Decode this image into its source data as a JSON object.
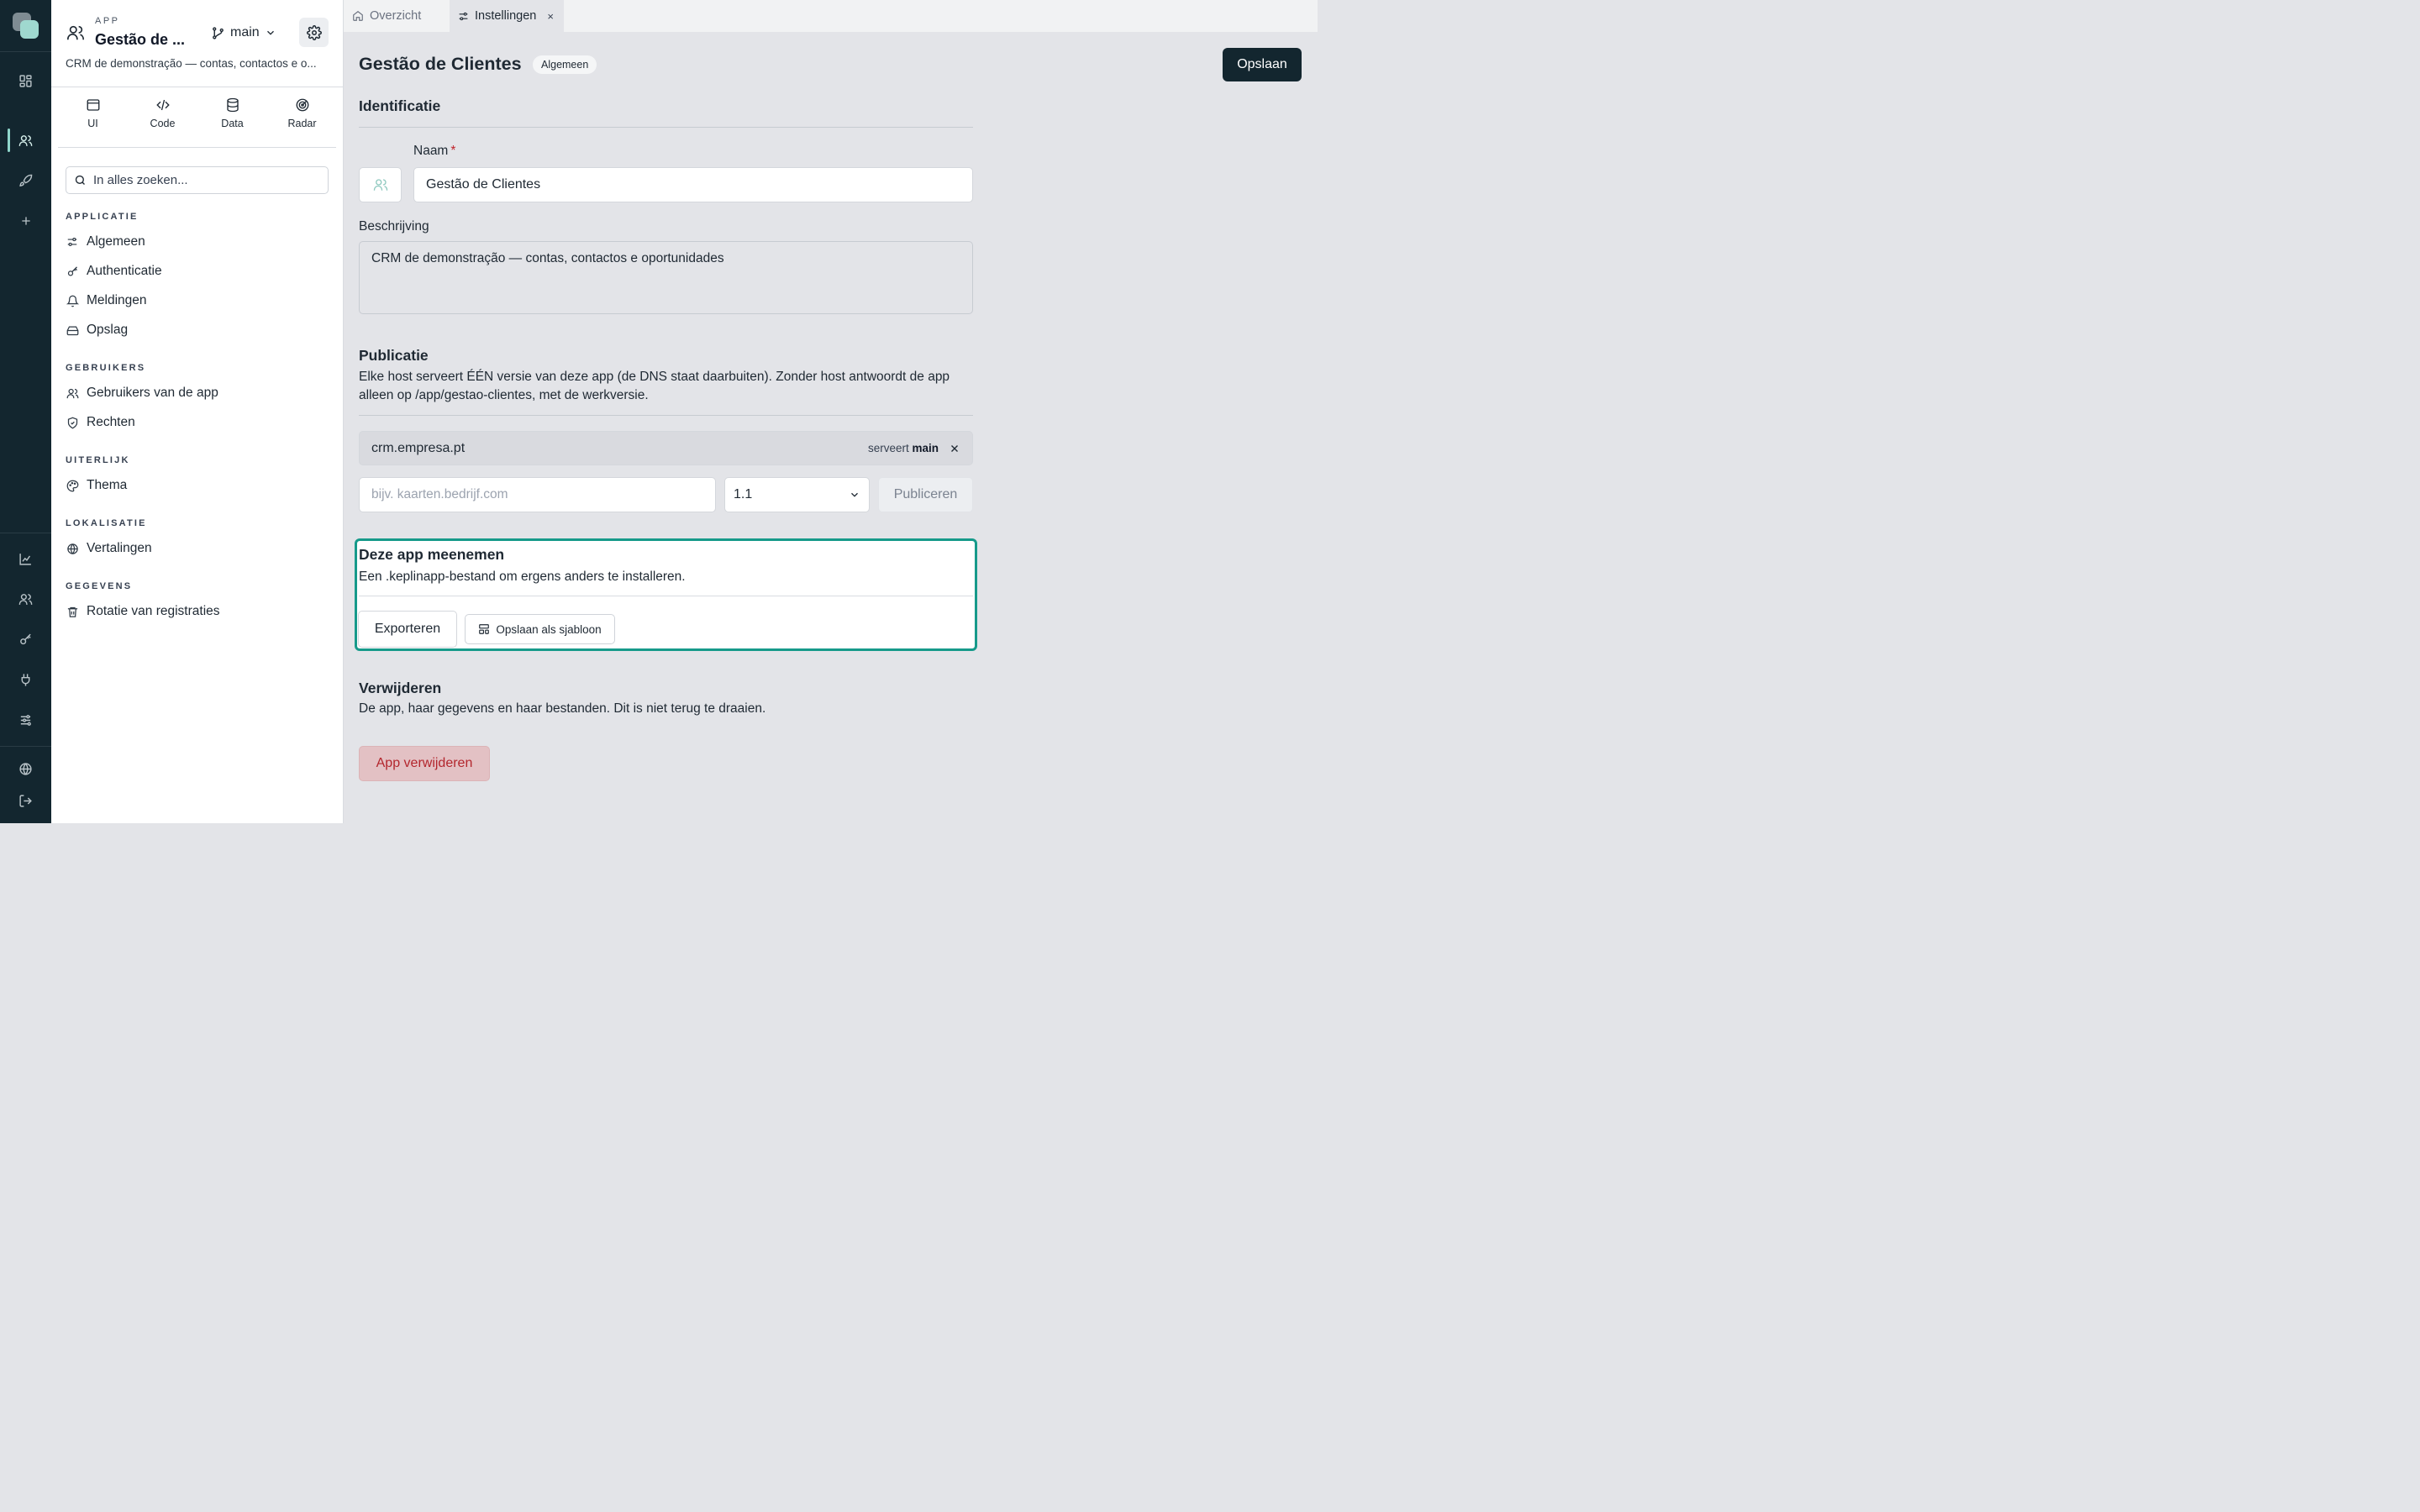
{
  "app": {
    "kicker": "APP",
    "title": "Gestão de ...",
    "branch": "main",
    "description": "CRM de demonstração — contas, contactos e o..."
  },
  "tools": [
    "UI",
    "Code",
    "Data",
    "Radar"
  ],
  "search": {
    "placeholder": "In alles zoeken..."
  },
  "sections": {
    "applicatie": "APPLICATIE",
    "gebruikers": "GEBRUIKERS",
    "uiterlijk": "UITERLIJK",
    "lokalisatie": "LOKALISATIE",
    "gegevens": "GEGEVENS"
  },
  "nav": {
    "algemeen": "Algemeen",
    "authenticatie": "Authenticatie",
    "meldingen": "Meldingen",
    "opslag": "Opslag",
    "gebruikers_app": "Gebruikers van de app",
    "rechten": "Rechten",
    "thema": "Thema",
    "vertalingen": "Vertalingen",
    "rotatie": "Rotatie van registraties"
  },
  "tabs": {
    "overzicht": "Overzicht",
    "instellingen": "Instellingen",
    "close": "×"
  },
  "page": {
    "title": "Gestão de Clientes",
    "badge": "Algemeen",
    "save_label": "Opslaan"
  },
  "identificatie": {
    "heading": "Identificatie",
    "name_label": "Naam",
    "required_mark": "*",
    "name_value": "Gestão de Clientes",
    "desc_label": "Beschrijving",
    "desc_value": "CRM de demonstração — contas, contactos e oportunidades"
  },
  "publicatie": {
    "heading": "Publicatie",
    "text": "Elke host serveert ÉÉN versie van deze app (de DNS staat daarbuiten). Zonder host antwoordt de app alleen op /app/gestao-clientes, met de werkversie.",
    "host": "crm.empresa.pt",
    "serves_label": "serveert",
    "serves_branch": "main",
    "host_placeholder": "bijv. kaarten.bedrijf.com",
    "version": "1.1",
    "publish_label": "Publiceren"
  },
  "export": {
    "heading": "Deze app meenemen",
    "text": "Een .keplinapp-bestand om ergens anders te installeren.",
    "export_label": "Exporteren",
    "template_label": "Opslaan als sjabloon"
  },
  "verwijderen": {
    "heading": "Verwijderen",
    "text": "De app, haar gegevens en haar bestanden. Dit is niet terug te draaien.",
    "delete_label": "App verwijderen"
  },
  "colors": {
    "rail": "#13262f",
    "accent": "#169a8a",
    "danger_text": "#b3262d",
    "danger_bg": "#e3c1c4"
  }
}
